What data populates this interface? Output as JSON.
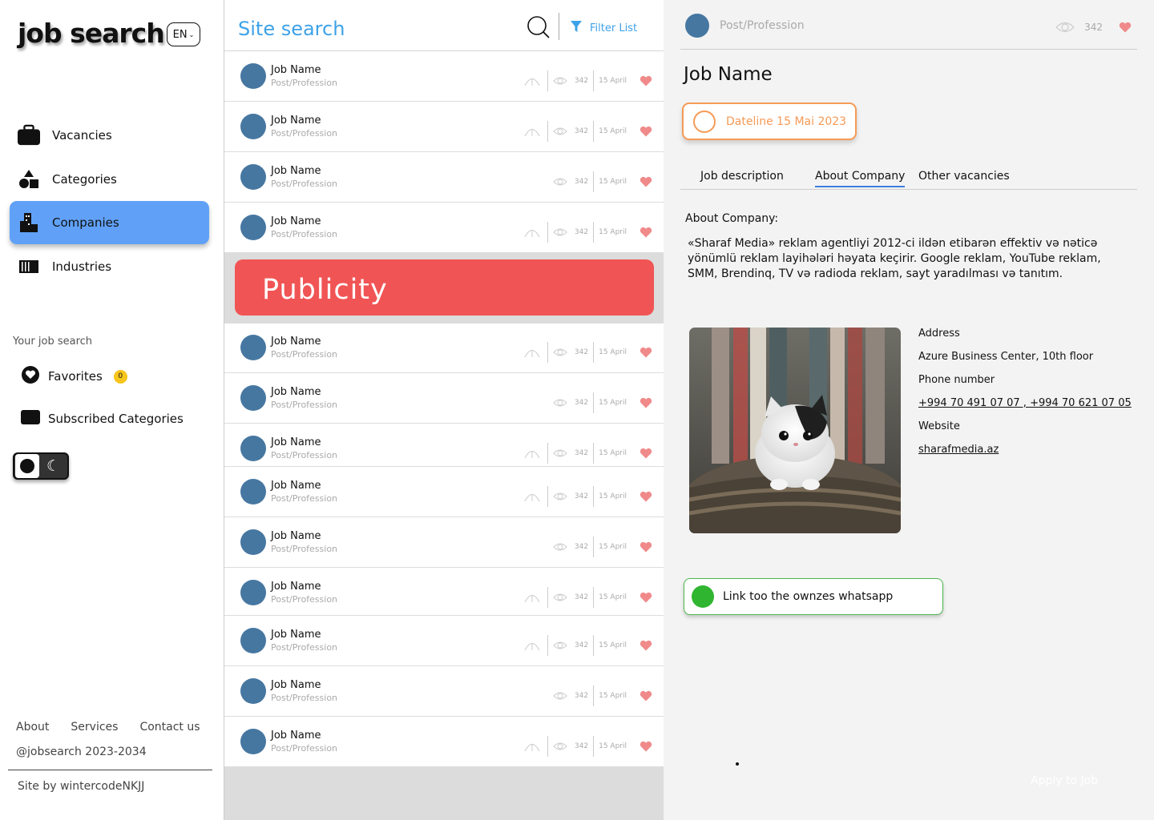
{
  "brand": {
    "logo": "job search",
    "language": "EN"
  },
  "sidebar": {
    "nav": [
      {
        "label": "Vacancies",
        "icon": "briefcase-icon"
      },
      {
        "label": "Categories",
        "icon": "shapes-icon"
      },
      {
        "label": "Companies",
        "icon": "building-icon",
        "active": true
      },
      {
        "label": "Industries",
        "icon": "factory-icon"
      }
    ],
    "section_label": "Your job search",
    "favorites": {
      "label": "Favorites",
      "count": "0"
    },
    "subscribed": {
      "label": "Subscribed Categories"
    }
  },
  "footer": {
    "links": [
      "About",
      "Services",
      "Contact us"
    ],
    "copyright": "@jobsearch 2023-2034",
    "site_by": "Site by wintercodeNKJJ"
  },
  "list": {
    "search_title": "Site search",
    "filter_label": "Filter List",
    "publicity_label": "Publicity",
    "jobs": [
      {
        "title": "Job Name",
        "subtitle": "Post/Profession",
        "views": "342",
        "date": "15 April",
        "has_hat": true
      },
      {
        "title": "Job Name",
        "subtitle": "Post/Profession",
        "views": "342",
        "date": "15 April",
        "has_hat": true
      },
      {
        "title": "Job Name",
        "subtitle": "Post/Profession",
        "views": "342",
        "date": "15 April",
        "has_hat": false
      },
      {
        "title": "Job Name",
        "subtitle": "Post/Profession",
        "views": "342",
        "date": "15 April",
        "has_hat": true
      },
      {
        "title": "Job Name",
        "subtitle": "Post/Profession",
        "views": "342",
        "date": "15 April",
        "has_hat": true
      },
      {
        "title": "Job Name",
        "subtitle": "Post/Profession",
        "views": "342",
        "date": "15 April",
        "has_hat": false
      },
      {
        "title": "Job Name",
        "subtitle": "Post/Profession",
        "views": "342",
        "date": "15 April",
        "has_hat": true
      },
      {
        "title": "Job Name",
        "subtitle": "Post/Profession",
        "views": "342",
        "date": "15 April",
        "has_hat": true
      },
      {
        "title": "Job Name",
        "subtitle": "Post/Profession",
        "views": "342",
        "date": "15 April",
        "has_hat": false
      },
      {
        "title": "Job Name",
        "subtitle": "Post/Profession",
        "views": "342",
        "date": "15 April",
        "has_hat": true
      },
      {
        "title": "Job Name",
        "subtitle": "Post/Profession",
        "views": "342",
        "date": "15 April",
        "has_hat": true
      },
      {
        "title": "Job Name",
        "subtitle": "Post/Profession",
        "views": "342",
        "date": "15 April",
        "has_hat": false
      },
      {
        "title": "Job Name",
        "subtitle": "Post/Profession",
        "views": "342",
        "date": "15 April",
        "has_hat": true
      }
    ]
  },
  "detail": {
    "post": "Post/Profession",
    "views": "342",
    "job_name": "Job Name",
    "deadline": "Dateline 15 Mai 2023",
    "tabs": [
      "Job description",
      "About Company",
      "Other vacancies"
    ],
    "about_label": "About Company:",
    "about_text": "«Sharaf Media» reklam agentliyi 2012-ci ildən etibarən effektiv və nəticə yönümlü reklam layihələri həyata keçirir. Google reklam, YouTube reklam, SMM, Brendinq, TV və radioda reklam, sayt yaradılması və tanıtım.",
    "address_label": "Address",
    "address": "Azure Business Center, 10th floor",
    "phone_label": "Phone number",
    "phone": "+994 70 491 07 07 , +994 70 621 07 05",
    "website_label": "Website",
    "website": "sharafmedia.az",
    "whatsapp_label": "Link too the ownzes whatsapp",
    "apply_label": "Apply to Job"
  },
  "colors": {
    "accent": "#60a1f7",
    "link": "#3ea2e8",
    "publicity": "#f15454",
    "deadline": "#f59a56",
    "whatsapp": "#2fb52f",
    "avatar": "#4677a1",
    "heart": "#f08a8a"
  }
}
